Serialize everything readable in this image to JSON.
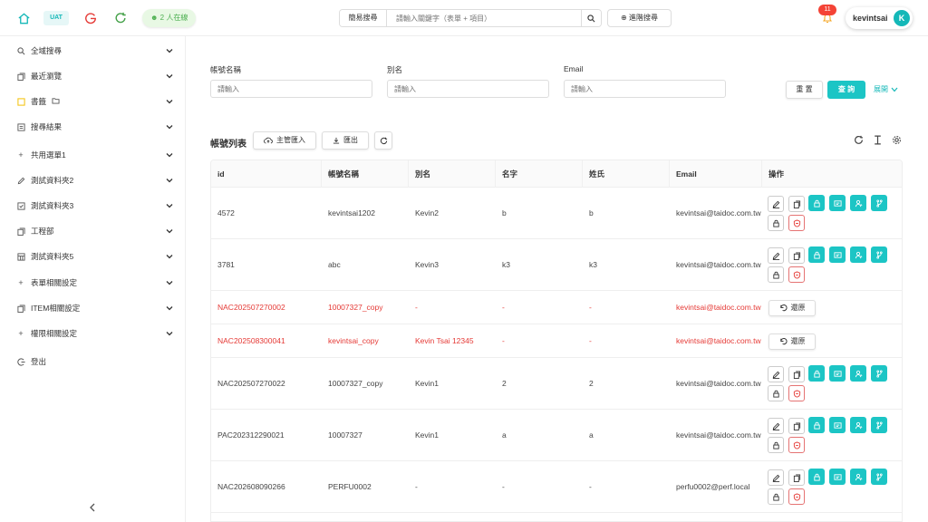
{
  "header": {
    "env_badge": "UAT",
    "online": "2 人在線",
    "search_mode": "簡易搜尋",
    "search_placeholder": "請輸入關鍵字（表單 + 項目）",
    "advanced_search": "進階搜尋",
    "notifications": "11",
    "username": "kevintsai",
    "avatar_letter": "K"
  },
  "sidebar": {
    "items": [
      {
        "label": "全域搜尋",
        "icon": "search-icon"
      },
      {
        "label": "最近瀏覽",
        "icon": "copy-icon"
      },
      {
        "label": "書籤",
        "icon": "bookmark-icon"
      },
      {
        "label": "搜尋結果",
        "icon": "list-icon"
      },
      {
        "label": "共用選單1",
        "icon": "plus-icon"
      },
      {
        "label": "測試資料夾2",
        "icon": "pencil-icon"
      },
      {
        "label": "測試資料夾3",
        "icon": "checkbox-icon"
      },
      {
        "label": "工程部",
        "icon": "copy-icon"
      },
      {
        "label": "測試資料夾5",
        "icon": "grid-icon"
      },
      {
        "label": "表單相關設定",
        "icon": "plus-icon"
      },
      {
        "label": "ITEM相關設定",
        "icon": "copy-icon"
      },
      {
        "label": "權限相關設定",
        "icon": "plus-icon"
      },
      {
        "label": "登出",
        "icon": "logout-icon"
      }
    ]
  },
  "filters": {
    "fields": [
      {
        "label": "帳號名稱",
        "placeholder": "請輸入"
      },
      {
        "label": "別名",
        "placeholder": "請輸入"
      },
      {
        "label": "Email",
        "placeholder": "請輸入"
      }
    ],
    "reset": "重 置",
    "query": "查 詢",
    "expand": "展開"
  },
  "list": {
    "title": "帳號列表",
    "import_btn": "主管匯入",
    "export_btn": "匯出"
  },
  "table": {
    "columns": [
      "id",
      "帳號名稱",
      "別名",
      "名字",
      "姓氏",
      "Email",
      "操作"
    ],
    "rows": [
      {
        "id": "4572",
        "account": "kevintsai1202",
        "alias": "Kevin2",
        "first": "b",
        "last": "b",
        "email": "kevintsai@taidoc.com.tw",
        "deleted": false
      },
      {
        "id": "3781",
        "account": "abc",
        "alias": "Kevin3",
        "first": "k3",
        "last": "k3",
        "email": "kevintsai@taidoc.com.tw",
        "deleted": false
      },
      {
        "id": "NAC202507270002",
        "account": "10007327_copy",
        "alias": "-",
        "first": "-",
        "last": "-",
        "email": "kevintsai@taidoc.com.tw",
        "deleted": true
      },
      {
        "id": "NAC202508300041",
        "account": "kevintsai_copy",
        "alias": "Kevin Tsai 12345",
        "first": "-",
        "last": "-",
        "email": "kevintsai@taidoc.com.tw",
        "deleted": true
      },
      {
        "id": "NAC202507270022",
        "account": "10007327_copy",
        "alias": "Kevin1",
        "first": "2",
        "last": "2",
        "email": "kevintsai@taidoc.com.tw",
        "deleted": false
      },
      {
        "id": "PAC202312290021",
        "account": "10007327",
        "alias": "Kevin1",
        "first": "a",
        "last": "a",
        "email": "kevintsai@taidoc.com.tw",
        "deleted": false
      },
      {
        "id": "NAC202608090266",
        "account": "PERFU0002",
        "alias": "-",
        "first": "-",
        "last": "-",
        "email": "perfu0002@perf.local",
        "deleted": false
      }
    ],
    "restore_label": "還原"
  },
  "colors": {
    "accent": "#1cc5c5",
    "danger": "#e53935",
    "success": "#4caf50"
  }
}
